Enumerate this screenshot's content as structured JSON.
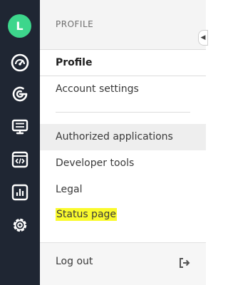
{
  "avatar": {
    "initial": "L",
    "color": "#3dd68c"
  },
  "rail": {
    "icons": [
      "dashboard-icon",
      "analytics-icon",
      "monitor-icon",
      "code-icon",
      "reports-icon",
      "settings-icon"
    ]
  },
  "panel": {
    "header": "PROFILE",
    "items": [
      {
        "label": "Profile",
        "active": true
      },
      {
        "label": "Account settings"
      },
      {
        "label": "Authorized applications",
        "hovered": true
      },
      {
        "label": "Developer tools"
      },
      {
        "label": "Legal"
      },
      {
        "label": "Status page",
        "highlighted": true,
        "highlight_color": "#fafa2d"
      }
    ],
    "logout_label": "Log out"
  }
}
